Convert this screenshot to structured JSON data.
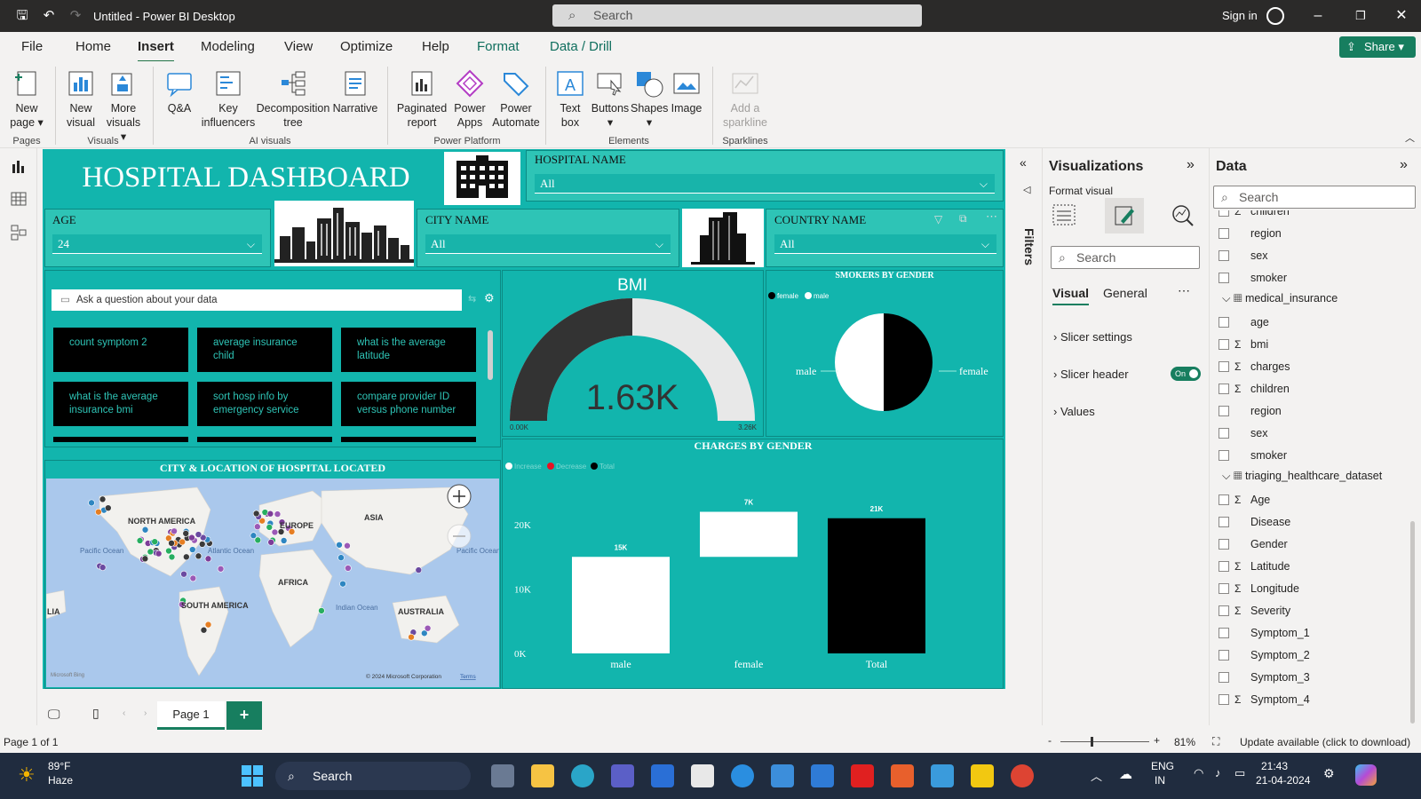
{
  "window": {
    "title": "Untitled - Power BI Desktop",
    "search_placeholder": "Search",
    "signin": "Sign in"
  },
  "menu": [
    "File",
    "Home",
    "Insert",
    "Modeling",
    "View",
    "Optimize",
    "Help",
    "Format",
    "Data / Drill"
  ],
  "menu_active": "Insert",
  "share_label": "Share",
  "ribbon": {
    "pages": {
      "new_page": "New page",
      "group": "Pages"
    },
    "visuals": {
      "new_visual": "New visual",
      "more_visuals": "More visuals",
      "group": "Visuals"
    },
    "ai": {
      "qa": "Q&A",
      "key_influencers": "Key influencers",
      "decomposition_tree": "Decomposition tree",
      "narrative": "Narrative",
      "group": "AI visuals"
    },
    "platform": {
      "paginated_report": "Paginated report",
      "power_apps": "Power Apps",
      "power_automate": "Power Automate",
      "group": "Power Platform"
    },
    "elements": {
      "text_box": "Text box",
      "buttons": "Buttons",
      "shapes": "Shapes",
      "image": "Image",
      "group": "Elements"
    },
    "sparklines": {
      "add_sparkline": "Add a sparkline",
      "group": "Sparklines"
    }
  },
  "dashboard": {
    "title": "HOSPITAL DASHBOARD",
    "hospital_name": {
      "label": "HOSPITAL NAME",
      "value": "All"
    },
    "age": {
      "label": "AGE",
      "value": "24"
    },
    "city_name": {
      "label": "CITY NAME",
      "value": "All"
    },
    "country_name": {
      "label": "COUNTRY NAME",
      "value": "All"
    },
    "qna": {
      "placeholder": "Ask a question about your data",
      "suggestions": [
        "count symptom 2",
        "average insurance child",
        "what is the average latitude",
        "what is the average insurance bmi",
        "sort hosp info by emergency service",
        "compare provider ID versus phone number"
      ]
    },
    "bmi": {
      "title": "BMI",
      "value_label": "1.63K",
      "min_label": "0.00K",
      "max_label": "3.26K"
    },
    "smokers": {
      "title": "SMOKERS BY GENDER",
      "legend": [
        "female",
        "male"
      ],
      "label_left": "male",
      "label_right": "female"
    },
    "map": {
      "title": "CITY & LOCATION OF HOSPITAL LOCATED",
      "labels": [
        "NORTH AMERICA",
        "EUROPE",
        "ASIA",
        "AFRICA",
        "SOUTH AMERICA",
        "AUSTRALIA",
        "Pacific Ocean",
        "Atlantic Ocean",
        "Indian Ocean",
        "Pacific Ocean",
        "LIA"
      ],
      "credit": "© 2024 Microsoft Corporation",
      "terms": "Terms",
      "brand": "Microsoft Bing"
    },
    "charges": {
      "title": "CHARGES BY GENDER",
      "legend": [
        "Increase",
        "Decrease",
        "Total"
      ]
    }
  },
  "chart_data": [
    {
      "type": "pie",
      "title": "SMOKERS BY GENDER",
      "labels": [
        "female",
        "male"
      ],
      "values": [
        50,
        50
      ],
      "colors": [
        "#000000",
        "#ffffff"
      ]
    },
    {
      "type": "gauge",
      "title": "BMI",
      "value": 1.63,
      "min": 0,
      "max": 3.26,
      "unit": "K"
    },
    {
      "type": "bar",
      "subtype": "waterfall",
      "title": "CHARGES BY GENDER",
      "categories": [
        "male",
        "female",
        "Total"
      ],
      "values": [
        15,
        7,
        21
      ],
      "bases": [
        0,
        15,
        0
      ],
      "value_labels": [
        "15K",
        "7K",
        "21K"
      ],
      "yticks": [
        "0K",
        "10K",
        "20K"
      ],
      "ylim": [
        0,
        24
      ],
      "colors": [
        "#ffffff",
        "#ffffff",
        "#000000"
      ]
    }
  ],
  "viz_pane": {
    "title": "Visualizations",
    "subtitle": "Format visual",
    "search": "Search",
    "tabs": [
      "Visual",
      "General"
    ],
    "sections": [
      "Slicer settings",
      "Slicer header",
      "Values"
    ],
    "toggle": "On"
  },
  "filters_label": "Filters",
  "data_pane": {
    "title": "Data",
    "search": "Search",
    "fields_top": [
      {
        "n": "children",
        "s": true
      },
      {
        "n": "region",
        "s": false
      },
      {
        "n": "sex",
        "s": false
      },
      {
        "n": "smoker",
        "s": false
      }
    ],
    "table2": "medical_insurance",
    "fields2": [
      {
        "n": "age",
        "s": false
      },
      {
        "n": "bmi",
        "s": true
      },
      {
        "n": "charges",
        "s": true
      },
      {
        "n": "children",
        "s": true
      },
      {
        "n": "region",
        "s": false
      },
      {
        "n": "sex",
        "s": false
      },
      {
        "n": "smoker",
        "s": false
      }
    ],
    "table3": "triaging_healthcare_dataset",
    "fields3": [
      {
        "n": "Age",
        "s": true
      },
      {
        "n": "Disease",
        "s": false
      },
      {
        "n": "Gender",
        "s": false
      },
      {
        "n": "Latitude",
        "s": true
      },
      {
        "n": "Longitude",
        "s": true
      },
      {
        "n": "Severity",
        "s": true
      },
      {
        "n": "Symptom_1",
        "s": false
      },
      {
        "n": "Symptom_2",
        "s": false
      },
      {
        "n": "Symptom_3",
        "s": false
      },
      {
        "n": "Symptom_4",
        "s": true
      }
    ]
  },
  "pages": {
    "current": "Page 1"
  },
  "status": {
    "page_of": "Page 1 of 1",
    "zoom": "81%",
    "update": "Update available (click to download)"
  },
  "taskbar": {
    "temp": "89°F",
    "weather": "Haze",
    "search": "Search",
    "lang1": "ENG",
    "lang2": "IN",
    "time": "21:43",
    "date": "21-04-2024"
  },
  "colors": {
    "teal": "#12b5ad",
    "teal_light": "#2ec4b6",
    "green": "#177e5f"
  }
}
